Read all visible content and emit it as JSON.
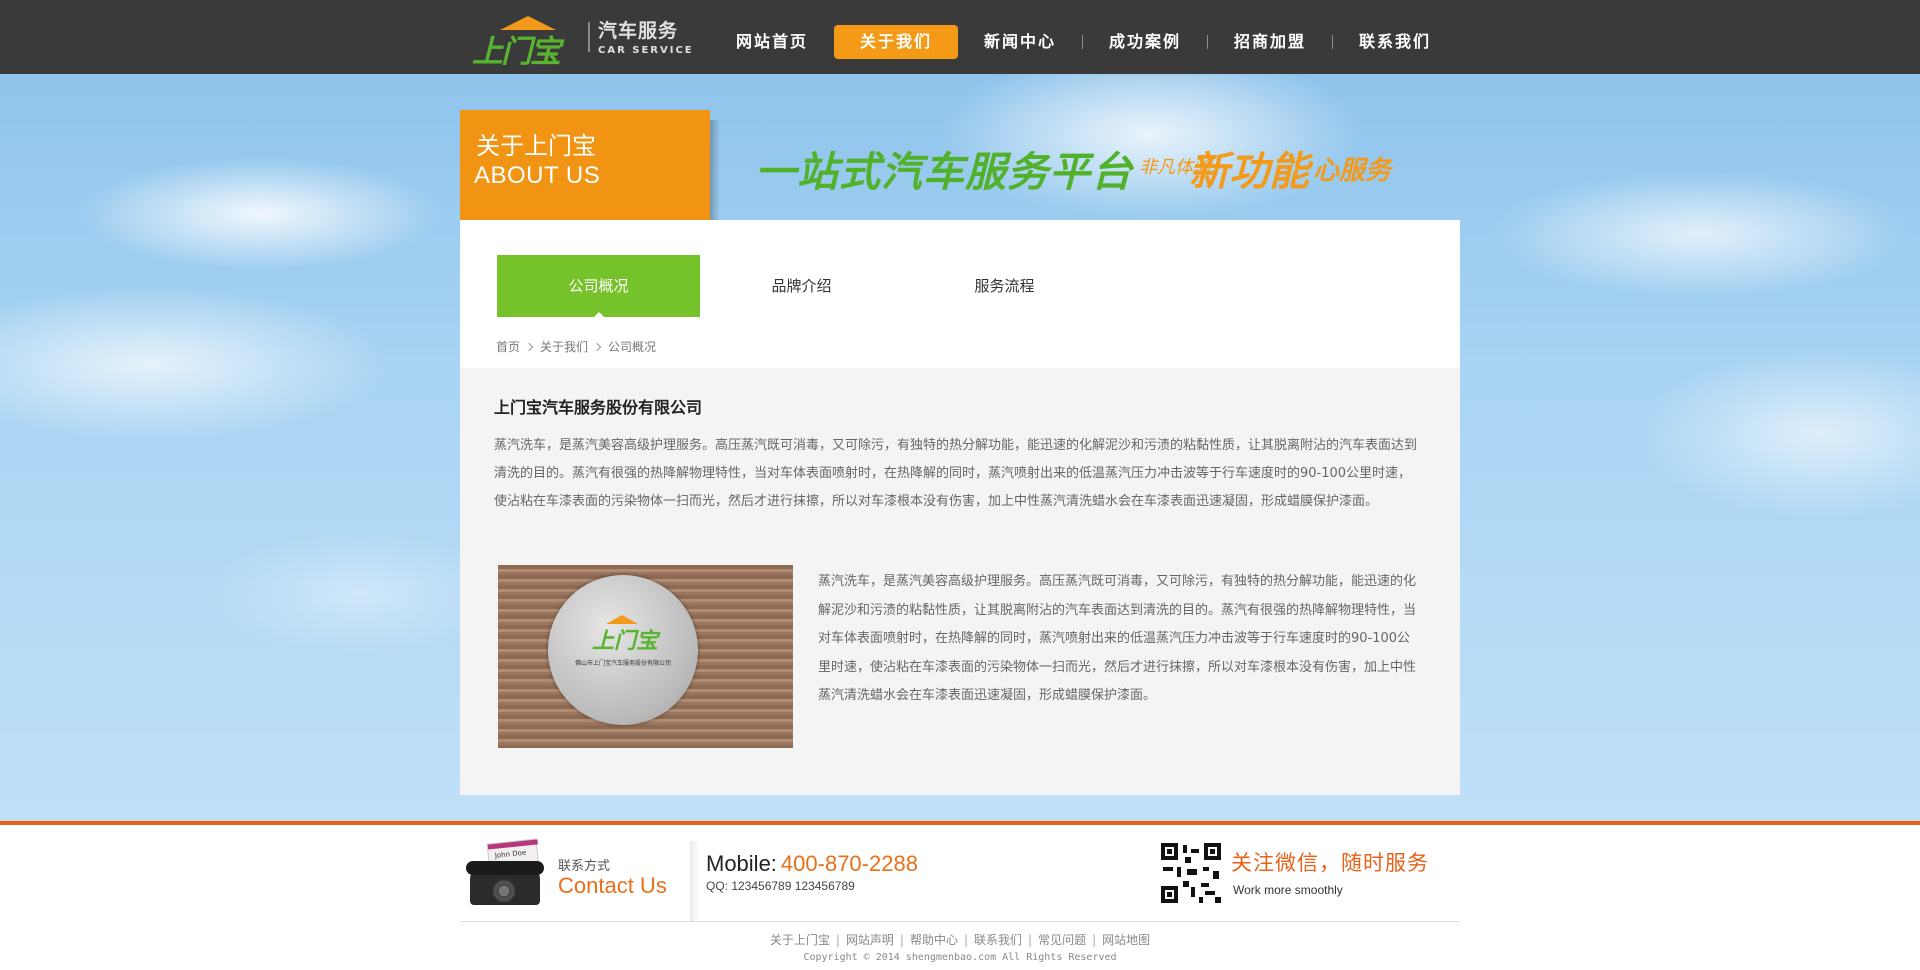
{
  "logo": {
    "brand": "上门宝",
    "cn": "汽车服务",
    "en": "CAR SERVICE"
  },
  "nav": {
    "items": [
      {
        "label": "网站首页"
      },
      {
        "label": "关于我们",
        "active": true
      },
      {
        "label": "新闻中心"
      },
      {
        "label": "成功案例"
      },
      {
        "label": "招商加盟"
      },
      {
        "label": "联系我们"
      }
    ],
    "active_color": "#f59a16"
  },
  "banner": {
    "about_cn": "关于上门宝",
    "about_en": "ABOUT US",
    "slogan_main": "一站式汽车服务平台",
    "slogan_small": "非凡体验",
    "slogan_new": "新功能",
    "slogan_heart": "心服务"
  },
  "tabs": [
    {
      "label": "公司概况",
      "active": true
    },
    {
      "label": "品牌介绍"
    },
    {
      "label": "服务流程"
    }
  ],
  "breadcrumb": [
    "首页",
    "关于我们",
    "公司概况"
  ],
  "content": {
    "title": "上门宝汽车服务股份有限公司",
    "para1": "蒸汽洗车，是蒸汽美容高级护理服务。高压蒸汽既可消毒，又可除污，有独特的热分解功能，能迅速的化解泥沙和污渍的粘黏性质，让其脱离附沾的汽车表面达到清洗的目的。蒸汽有很强的热降解物理特性，当对车体表面喷射时，在热降解的同时，蒸汽喷射出来的低温蒸汽压力冲击波等于行车速度时的90-100公里时速，使沾粘在车漆表面的污染物体一扫而光，然后才进行抹擦，所以对车漆根本没有伤害，加上中性蒸汽清洗蜡水会在车漆表面迅速凝固，形成蜡膜保护漆面。",
    "para2": "蒸汽洗车，是蒸汽美容高级护理服务。高压蒸汽既可消毒，又可除污，有独特的热分解功能，能迅速的化解泥沙和污渍的粘黏性质，让其脱离附沾的汽车表面达到清洗的目的。蒸汽有很强的热降解物理特性，当对车体表面喷射时，在热降解的同时，蒸汽喷射出来的低温蒸汽压力冲击波等于行车速度时的90-100公里时速，使沾粘在车漆表面的污染物体一扫而光，然后才进行抹擦，所以对车漆根本没有伤害，加上中性蒸汽清洗蜡水会在车漆表面迅速凝固，形成蜡膜保护漆面。",
    "photo_brand": "上门宝",
    "photo_caption": "佛山市上门宝汽车服务股份有限公司"
  },
  "footer": {
    "contact_cn": "联系方式",
    "contact_en": "Contact Us",
    "card_name": "John Doe",
    "mobile_label": "Mobile:",
    "mobile_number": "400-870-2288",
    "qq": "QQ: 123456789    123456789",
    "wechat_title": "关注微信，随时服务",
    "wechat_sub": "Work more smoothly",
    "links": [
      "关于上门宝",
      "网站声明",
      "帮助中心",
      "联系我们",
      "常见问题",
      "网站地图"
    ],
    "copyright": "Copyright © 2014 shengmenbao.com All Rights Reserved"
  }
}
